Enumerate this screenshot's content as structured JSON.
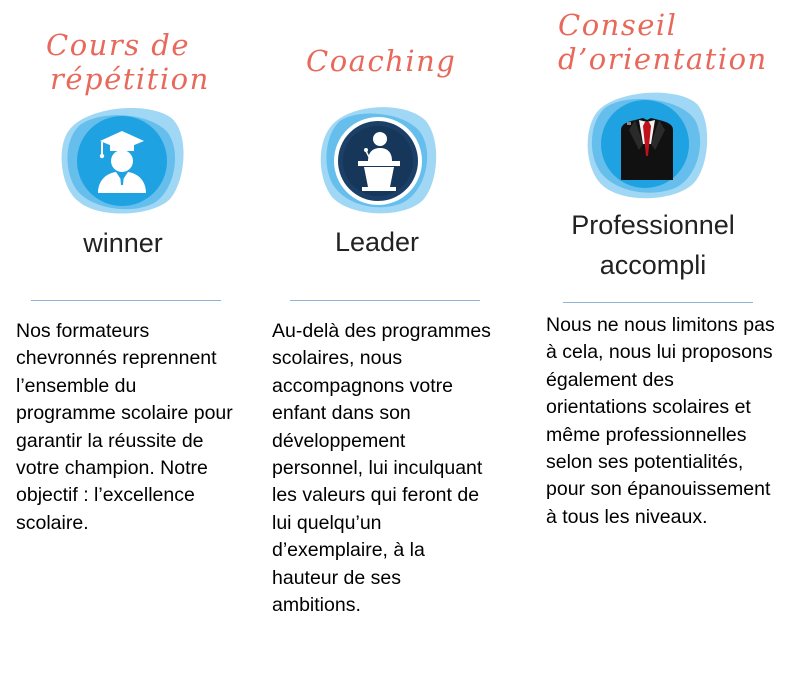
{
  "columns": [
    {
      "title_lines": [
        "Cours de",
        "répétition"
      ],
      "icon": "graduate-icon",
      "subtitle_lines": [
        "winner"
      ],
      "description": "Nos formateurs chevronnés reprennent l’ensemble du programme scolaire pour garantir la réussite de votre champion. Notre objectif : l’excellence scolaire."
    },
    {
      "title_lines": [
        "Coaching"
      ],
      "icon": "speaker-podium-icon",
      "subtitle_lines": [
        "Leader"
      ],
      "description": "Au-delà des programmes scolaires, nous accompagnons votre enfant dans son développement personnel, lui inculquant les valeurs qui feront de lui quelqu’un d’exemplaire, à la hauteur de ses ambitions."
    },
    {
      "title_lines": [
        "Conseil",
        "d’orientation"
      ],
      "icon": "business-suit-icon",
      "subtitle_lines": [
        "Professionnel",
        "accompli"
      ],
      "description": "Nous ne nous limitons pas à cela, nous lui proposons également des orientations scolaires et même professionnelles selon ses potentialités, pour son épanouissement à tous les niveaux."
    }
  ],
  "colors": {
    "script": "#e8695b",
    "blob_light": "#8fd0f2",
    "blob_dark": "#22a3e3",
    "rule": "#8eb4d6"
  }
}
